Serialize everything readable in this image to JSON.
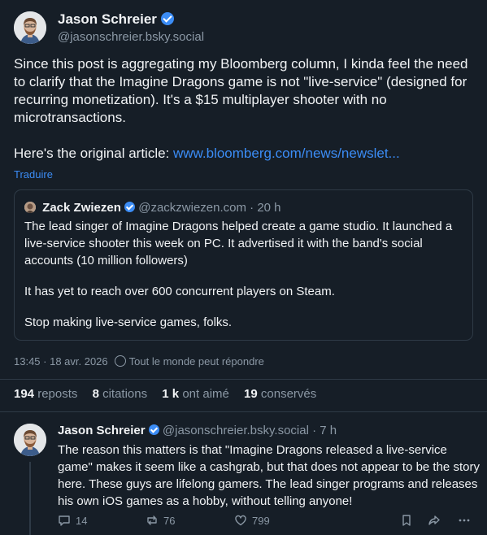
{
  "main_post": {
    "author_name": "Jason Schreier",
    "author_handle": "@jasonschreier.bsky.social",
    "text_p1": "Since this post is aggregating my Bloomberg column, I kinda feel the need to clarify that the Imagine Dragons game is not \"live-service\" (designed for recurring monetization). It's a $15 multiplayer shooter with no microtransactions.",
    "text_p2_prefix": "Here's the original article: ",
    "link": "www.bloomberg.com/news/newslet...",
    "translate_label": "Traduire",
    "timestamp": "13:45 · 18 avr. 2026",
    "reply_setting": "Tout le monde peut répondre"
  },
  "quoted_post": {
    "author_name": "Zack Zwiezen",
    "author_handle": "@zackzwiezen.com",
    "time": "· 20 h",
    "p1": "The lead singer of Imagine Dragons helped create a game studio. It launched a live-service shooter this week on PC. It advertised it with the band's social accounts (10 million followers)",
    "p2": "It has yet to reach over 600 concurrent players on Steam.",
    "p3": "Stop making live-service games, folks."
  },
  "stats": {
    "reposts_count": "194",
    "reposts_label": "reposts",
    "citations_count": "8",
    "citations_label": "citations",
    "likes_count": "1 k",
    "likes_label": "ont aimé",
    "saves_count": "19",
    "saves_label": "conservés"
  },
  "reply": {
    "author_name": "Jason Schreier",
    "author_handle": "@jasonschreier.bsky.social",
    "time": "· 7 h",
    "text": "The reason this matters is that \"Imagine Dragons released a live-service game\" makes it seem like a cashgrab, but that does not appear to be the story here. These guys are lifelong gamers. The lead singer programs and releases his own iOS games as a hobby, without telling anyone!",
    "reply_count": "14",
    "repost_count": "76",
    "like_count": "799"
  }
}
